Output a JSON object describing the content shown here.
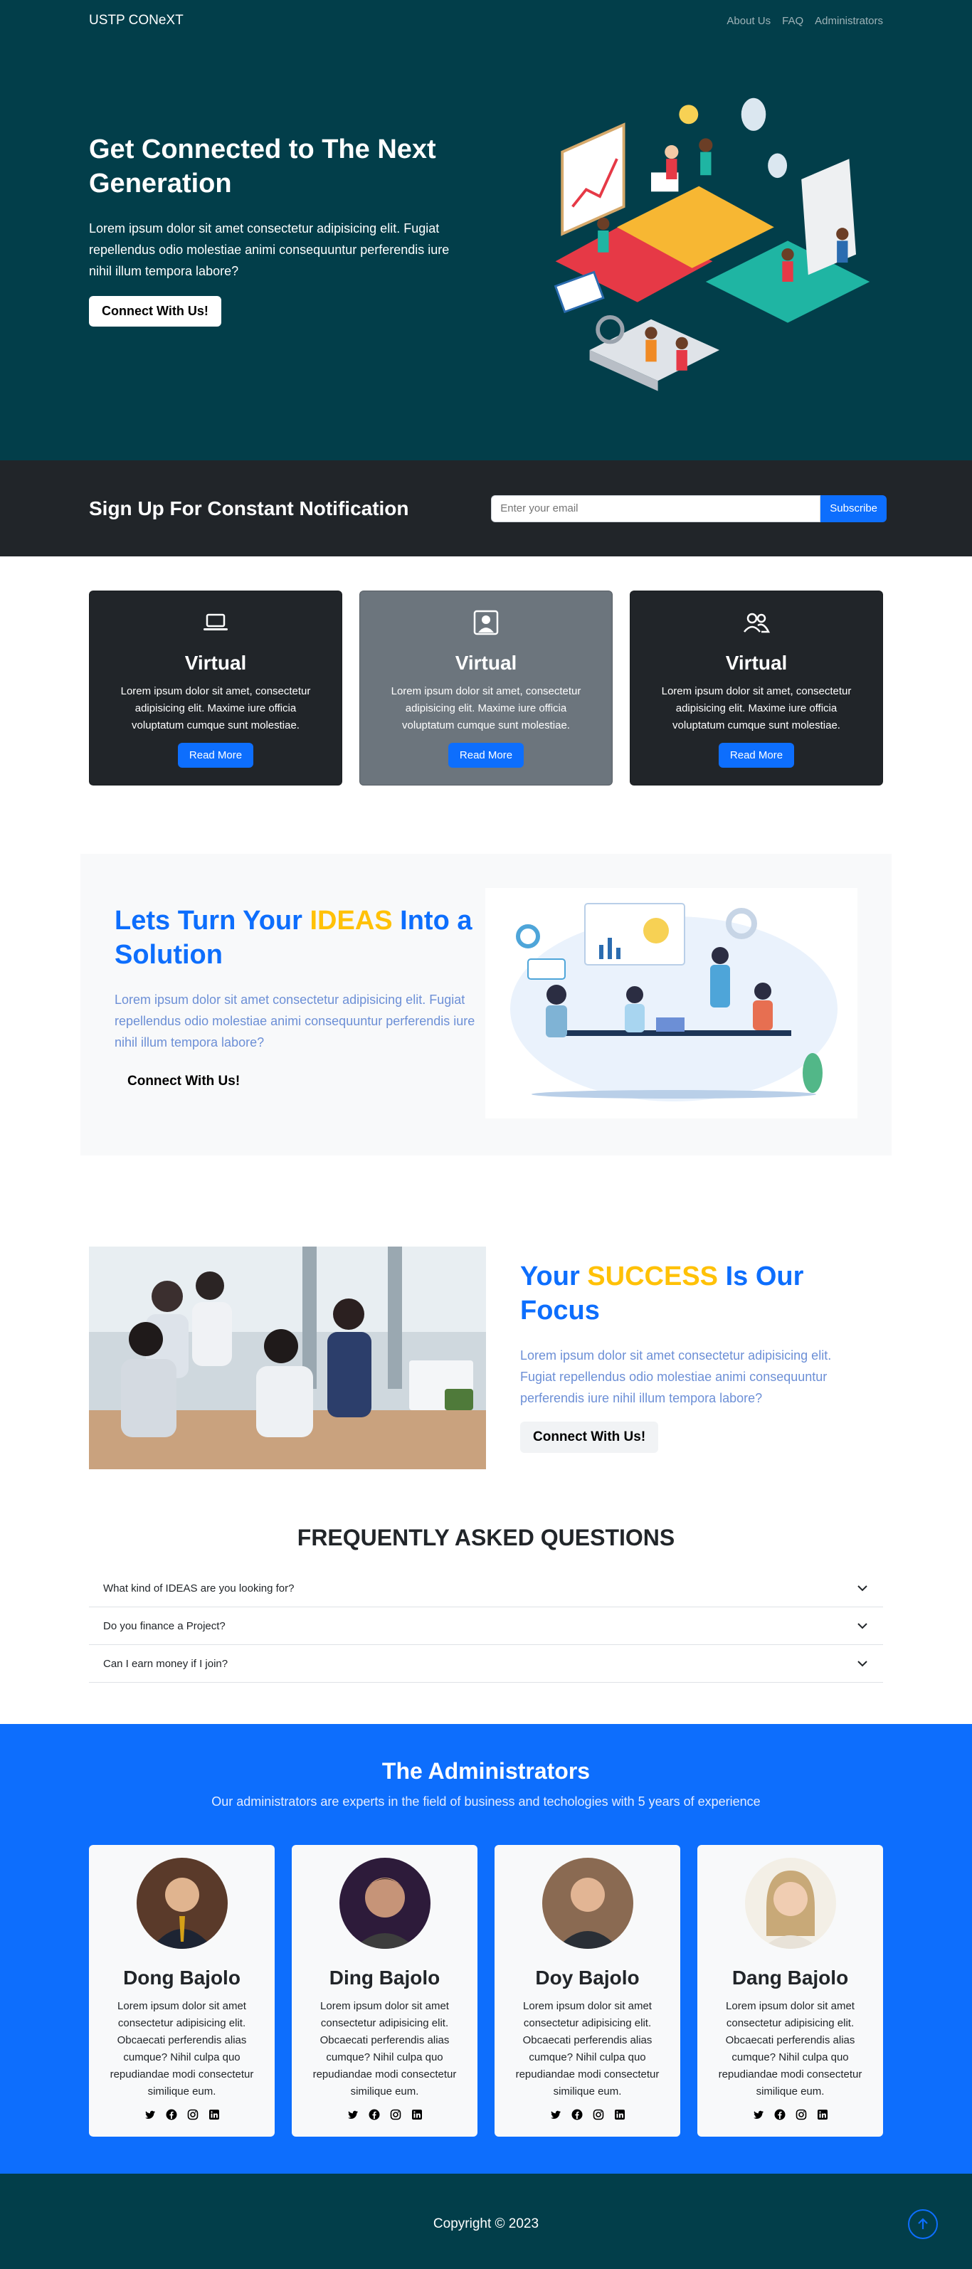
{
  "nav": {
    "brand": "USTP CONeXT",
    "links": [
      "About Us",
      "FAQ",
      "Administrators"
    ]
  },
  "hero": {
    "title": "Get Connected to The Next Generation",
    "description": "Lorem ipsum dolor sit amet consectetur adipisicing elit. Fugiat repellendus odio molestiae animi consequuntur perferendis iure nihil illum tempora labore?",
    "button": "Connect With Us!"
  },
  "signup": {
    "title": "Sign Up For Constant Notification",
    "placeholder": "Enter your email",
    "button": "Subscribe"
  },
  "cards": [
    {
      "icon": "laptop-icon",
      "title": "Virtual",
      "text": "Lorem ipsum dolor sit amet, consectetur adipisicing elit. Maxime iure officia voluptatum cumque sunt molestiae.",
      "button": "Read More"
    },
    {
      "icon": "person-square-icon",
      "title": "Virtual",
      "text": "Lorem ipsum dolor sit amet, consectetur adipisicing elit. Maxime iure officia voluptatum cumque sunt molestiae.",
      "button": "Read More"
    },
    {
      "icon": "people-icon",
      "title": "Virtual",
      "text": "Lorem ipsum dolor sit amet, consectetur adipisicing elit. Maxime iure officia voluptatum cumque sunt molestiae.",
      "button": "Read More"
    }
  ],
  "ideas": {
    "title_pre": "Lets Turn Your ",
    "title_accent": "IDEAS",
    "title_post": " Into a Solution",
    "description": "Lorem ipsum dolor sit amet consectetur adipisicing elit. Fugiat repellendus odio molestiae animi consequuntur perferendis iure nihil illum tempora labore?",
    "button": "Connect With Us!"
  },
  "success": {
    "title_pre": "Your ",
    "title_accent": "SUCCESS",
    "title_post": " Is Our Focus",
    "description": "Lorem ipsum dolor sit amet consectetur adipisicing elit. Fugiat repellendus odio molestiae animi consequuntur perferendis iure nihil illum tempora labore?",
    "button": "Connect With Us!"
  },
  "faq": {
    "title": "FREQUENTLY ASKED QUESTIONS",
    "items": [
      "What kind of IDEAS are you looking for?",
      "Do you finance a Project?",
      "Can I earn money if I join?"
    ]
  },
  "admins": {
    "title": "The Administrators",
    "subtitle": "Our administrators are experts in the field of business and techologies with 5 years of experience",
    "people": [
      {
        "name": "Dong Bajolo",
        "text": "Lorem ipsum dolor sit amet consectetur adipisicing elit. Obcaecati perferendis alias cumque? Nihil culpa quo repudiandae modi consectetur similique eum."
      },
      {
        "name": "Ding Bajolo",
        "text": "Lorem ipsum dolor sit amet consectetur adipisicing elit. Obcaecati perferendis alias cumque? Nihil culpa quo repudiandae modi consectetur similique eum."
      },
      {
        "name": "Doy Bajolo",
        "text": "Lorem ipsum dolor sit amet consectetur adipisicing elit. Obcaecati perferendis alias cumque? Nihil culpa quo repudiandae modi consectetur similique eum."
      },
      {
        "name": "Dang Bajolo",
        "text": "Lorem ipsum dolor sit amet consectetur adipisicing elit. Obcaecati perferendis alias cumque? Nihil culpa quo repudiandae modi consectetur similique eum."
      }
    ],
    "social_icons": [
      "twitter-icon",
      "facebook-icon",
      "instagram-icon",
      "linkedin-icon"
    ]
  },
  "footer": {
    "copyright": "Copyright © 2023"
  },
  "colors": {
    "primary": "#0d6efd",
    "accent": "#ffc107",
    "teal_dark": "#023e4a",
    "dark": "#212529",
    "gray": "#6c757d"
  }
}
